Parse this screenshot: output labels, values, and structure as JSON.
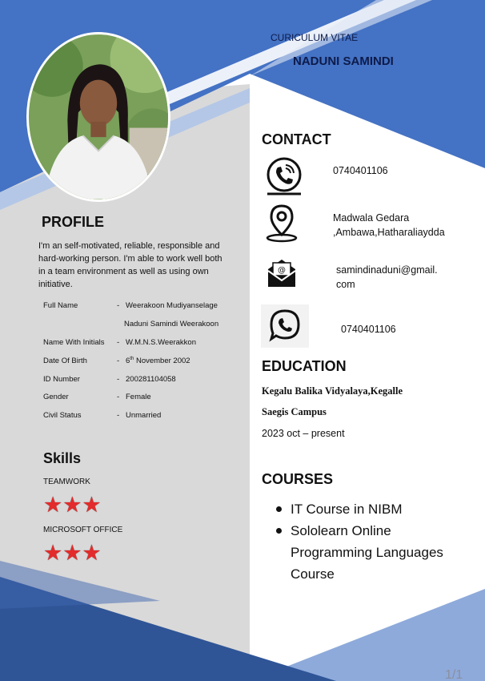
{
  "header": {
    "cv_label": "CURICULUM VITAE",
    "name": "NADUNI SAMINDI"
  },
  "colors": {
    "primary_blue": "#4472c4",
    "dark_blue": "#2f5597",
    "light_blue": "#8eaadb",
    "sidebar_gray": "#d9d9d9",
    "star_red": "#e32b2b"
  },
  "profile": {
    "title": "PROFILE",
    "text": "I'm an self-motivated, reliable, responsible and hard-working person. I'm able to work well both in a team environment as well as using own initiative.",
    "fields": [
      {
        "key": "Full Name",
        "dash": "-",
        "value": "Weerakoon Mudiyanselage"
      },
      {
        "key": "Name With Initials",
        "dash": "-",
        "value": "W.M.N.S.Weerakkon"
      },
      {
        "key": "Date Of Birth",
        "dash": "-",
        "value_pre": "6",
        "value_sup": "th",
        "value_post": " November 2002"
      },
      {
        "key": "ID  Number",
        "dash": "-",
        "value": "200281104058"
      },
      {
        "key": "Gender",
        "dash": "-",
        "value": "Female"
      },
      {
        "key": "Civil Status",
        "dash": "-",
        "value": "Unmarried"
      }
    ],
    "full_name_cont": "Naduni Samindi Weerakoon"
  },
  "skills": {
    "title": "Skills",
    "items": [
      {
        "name": "TEAMWORK",
        "stars": "★★★",
        "rating": 3
      },
      {
        "name": "MICROSOFT OFFICE",
        "stars": "★★★",
        "rating": 3
      }
    ]
  },
  "contact": {
    "title": "CONTACT",
    "phone": "0740401106",
    "address_line1": "Madwala Gedara",
    "address_line2": ",Ambawa,Hatharaliaydda",
    "email_line1": "samindinaduni@gmail.",
    "email_line2": "com",
    "whatsapp": "0740401106",
    "icons": [
      "phone-icon",
      "location-pin-icon",
      "email-icon",
      "whatsapp-icon"
    ]
  },
  "education": {
    "title": "EDUCATION",
    "schools": [
      "Kegalu Balika Vidyalaya,Kegalle",
      "Saegis Campus"
    ],
    "date": "2023 oct – present"
  },
  "courses": {
    "title": "COURSES",
    "items": [
      "IT Course in NIBM",
      "Sololearn Online Programming Languages Course"
    ]
  },
  "footer": {
    "page_number": "1/1"
  }
}
